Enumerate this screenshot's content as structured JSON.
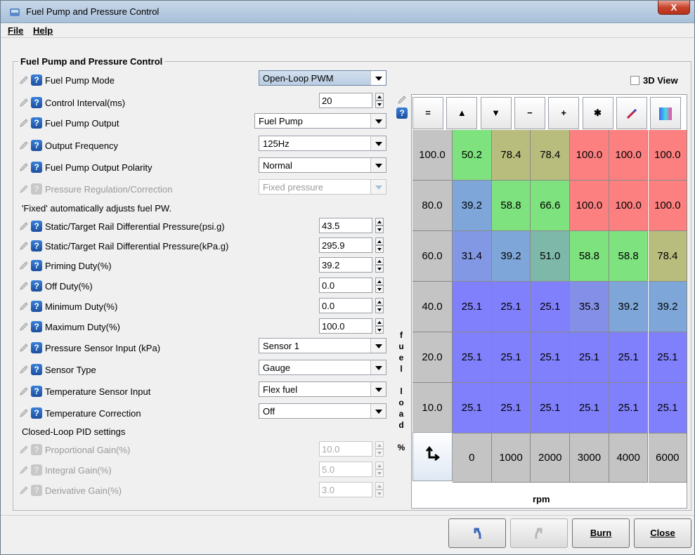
{
  "window": {
    "title": "Fuel Pump and Pressure Control",
    "close_label": "X"
  },
  "menu": {
    "file": "File",
    "help": "Help"
  },
  "group_title": "Fuel Pump and Pressure Control",
  "view3d_label": "3D View",
  "fields": {
    "fuel_pump_mode": {
      "label": "Fuel Pump Mode",
      "value": "Open-Loop PWM"
    },
    "control_interval": {
      "label": "Control Interval(ms)",
      "value": "20"
    },
    "fuel_pump_output": {
      "label": "Fuel Pump Output",
      "value": "Fuel Pump"
    },
    "output_frequency": {
      "label": "Output Frequency",
      "value": "125Hz"
    },
    "output_polarity": {
      "label": "Fuel Pump Output Polarity",
      "value": "Normal"
    },
    "pressure_regulation": {
      "label": "Pressure Regulation/Correction",
      "value": "Fixed pressure"
    },
    "fixed_note": "'Fixed' automatically adjusts fuel PW.",
    "static_psi": {
      "label": "Static/Target Rail Differential Pressure(psi.g)",
      "value": "43.5"
    },
    "static_kpa": {
      "label": "Static/Target Rail Differential Pressure(kPa.g)",
      "value": "295.9"
    },
    "priming_duty": {
      "label": "Priming Duty(%)",
      "value": "39.2"
    },
    "off_duty": {
      "label": "Off Duty(%)",
      "value": "0.0"
    },
    "min_duty": {
      "label": "Minimum Duty(%)",
      "value": "0.0"
    },
    "max_duty": {
      "label": "Maximum Duty(%)",
      "value": "100.0"
    },
    "pressure_sensor_input": {
      "label": "Pressure Sensor Input (kPa)",
      "value": "Sensor 1"
    },
    "sensor_type": {
      "label": "Sensor Type",
      "value": "Gauge"
    },
    "temp_sensor_input": {
      "label": "Temperature Sensor Input",
      "value": "Flex fuel"
    },
    "temp_correction": {
      "label": "Temperature Correction",
      "value": "Off"
    },
    "pid_heading": "Closed-Loop PID settings",
    "p_gain": {
      "label": "Proportional Gain(%)",
      "value": "10.0"
    },
    "i_gain": {
      "label": "Integral Gain(%)",
      "value": "5.0"
    },
    "d_gain": {
      "label": "Derivative Gain(%)",
      "value": "3.0"
    }
  },
  "table": {
    "toolbar": [
      "=",
      "▲",
      "▼",
      "−",
      "+",
      "✱",
      "/",
      ""
    ],
    "y_axis_label": [
      "f",
      "u",
      "e",
      "l",
      "",
      "l",
      "o",
      "a",
      "d",
      "",
      "%"
    ],
    "x_axis_label": "rpm",
    "loads": [
      "100.0",
      "80.0",
      "60.0",
      "40.0",
      "20.0",
      "10.0"
    ],
    "rpms": [
      "0",
      "1000",
      "2000",
      "3000",
      "4000",
      "6000"
    ],
    "values": [
      [
        "50.2",
        "78.4",
        "78.4",
        "100.0",
        "100.0",
        "100.0"
      ],
      [
        "39.2",
        "58.8",
        "66.6",
        "100.0",
        "100.0",
        "100.0"
      ],
      [
        "31.4",
        "39.2",
        "51.0",
        "58.8",
        "58.8",
        "78.4"
      ],
      [
        "25.1",
        "25.1",
        "25.1",
        "35.3",
        "39.2",
        "39.2"
      ],
      [
        "25.1",
        "25.1",
        "25.1",
        "25.1",
        "25.1",
        "25.1"
      ],
      [
        "25.1",
        "25.1",
        "25.1",
        "25.1",
        "25.1",
        "25.1"
      ]
    ],
    "colors": [
      [
        "#7ee27e",
        "#b8bd7e",
        "#b8bd7e",
        "#fd8080",
        "#fd8080",
        "#fd8080"
      ],
      [
        "#7ea6d8",
        "#7ee27e",
        "#7ee27e",
        "#fd8080",
        "#fd8080",
        "#fd8080"
      ],
      [
        "#8298e4",
        "#7ea6d8",
        "#7eb8a8",
        "#7ee27e",
        "#7ee27e",
        "#b8bd7e"
      ],
      [
        "#8080fc",
        "#8080fc",
        "#8080fc",
        "#8490e8",
        "#7ea6d8",
        "#7ea6d8"
      ],
      [
        "#8080fc",
        "#8080fc",
        "#8080fc",
        "#8080fc",
        "#8080fc",
        "#8080fc"
      ],
      [
        "#8080fc",
        "#8080fc",
        "#8080fc",
        "#8080fc",
        "#8080fc",
        "#8080fc"
      ]
    ]
  },
  "buttons": {
    "burn": "Burn",
    "close": "Close"
  }
}
